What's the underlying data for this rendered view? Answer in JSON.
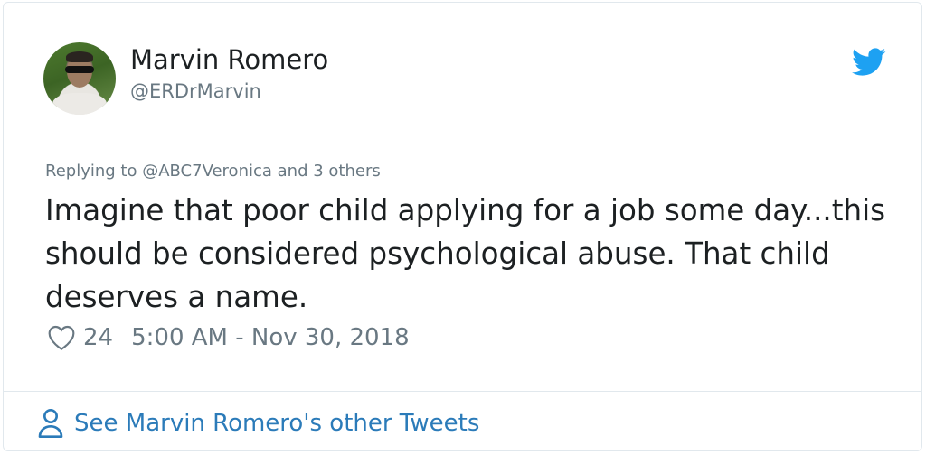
{
  "author": {
    "display_name": "Marvin Romero",
    "handle": "@ERDrMarvin"
  },
  "tweet": {
    "replying_to": "Replying to @ABC7Veronica and 3 others",
    "text": "Imagine that poor child applying for a job some day...this should be considered psychological abuse. That child deserves a name.",
    "likes": "24",
    "timestamp": "5:00 AM - Nov 30, 2018"
  },
  "footer": {
    "link_label": "See Marvin Romero's other Tweets"
  },
  "icons": {
    "brand": "twitter-bird-icon",
    "like": "heart-icon",
    "profile": "person-icon"
  },
  "colors": {
    "brand_blue": "#1da1f2",
    "link_blue": "#2b7bb9",
    "muted_text": "#697882",
    "border": "#e1e8ed"
  }
}
